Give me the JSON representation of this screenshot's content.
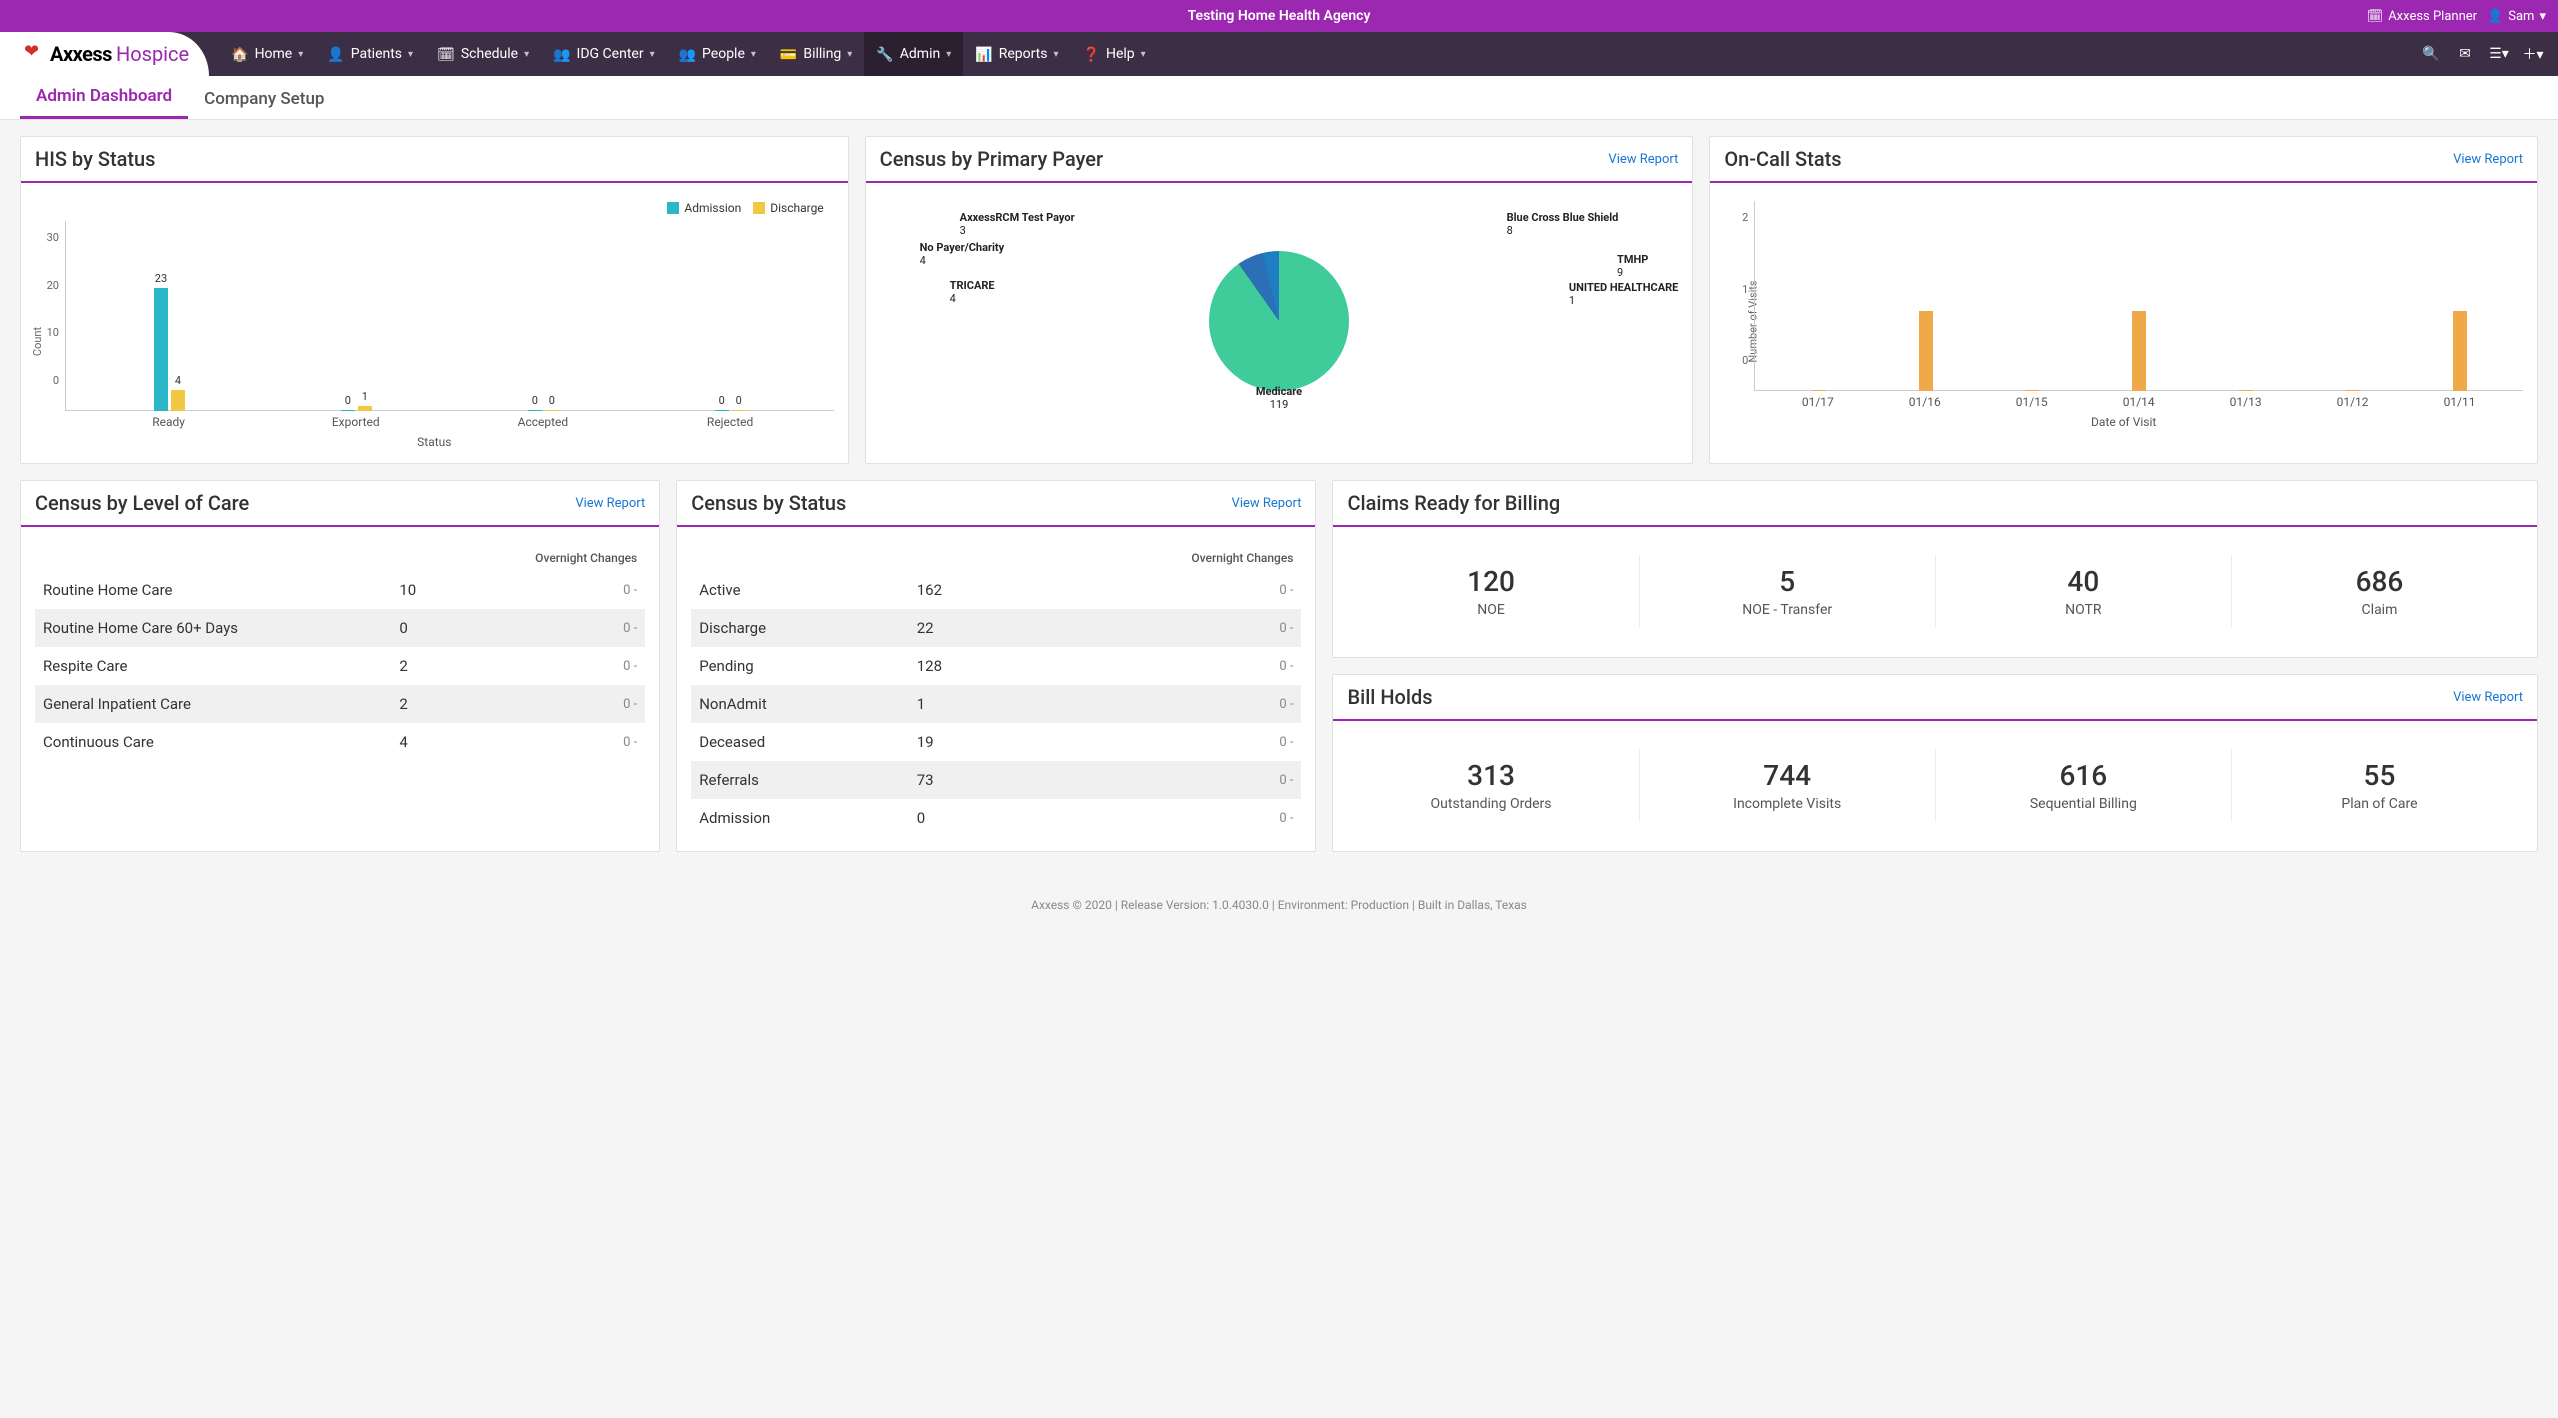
{
  "header": {
    "agency_name": "Testing Home Health Agency",
    "planner_link": "Axxess Planner",
    "user_name": "Sam"
  },
  "logo": {
    "brand": "Axxess",
    "product": "Hospice"
  },
  "nav": [
    {
      "icon": "home",
      "label": "Home"
    },
    {
      "icon": "person",
      "label": "Patients"
    },
    {
      "icon": "calendar",
      "label": "Schedule"
    },
    {
      "icon": "group",
      "label": "IDG Center"
    },
    {
      "icon": "people",
      "label": "People"
    },
    {
      "icon": "money",
      "label": "Billing"
    },
    {
      "icon": "wrench",
      "label": "Admin",
      "active": true
    },
    {
      "icon": "chart",
      "label": "Reports"
    },
    {
      "icon": "help",
      "label": "Help"
    }
  ],
  "tabs": [
    {
      "label": "Admin Dashboard",
      "active": true
    },
    {
      "label": "Company Setup"
    }
  ],
  "cards": {
    "his_by_status": {
      "title": "HIS by Status",
      "legend": [
        {
          "label": "Admission",
          "color": "#29b6c6"
        },
        {
          "label": "Discharge",
          "color": "#f2c744"
        }
      ],
      "xlabel": "Status",
      "ylabel": "Count"
    },
    "census_by_primary_payer": {
      "title": "Census by Primary Payer",
      "view_report": "View Report"
    },
    "on_call_stats": {
      "title": "On-Call Stats",
      "view_report": "View Report",
      "xlabel": "Date of Visit",
      "ylabel": "Number of Visits"
    },
    "census_by_level_of_care": {
      "title": "Census by Level of Care",
      "view_report": "View Report",
      "col_changes": "Overnight Changes",
      "rows": [
        {
          "label": "Routine Home Care",
          "value": "10",
          "change": "0 -"
        },
        {
          "label": "Routine Home Care 60+ Days",
          "value": "0",
          "change": "0 -"
        },
        {
          "label": "Respite Care",
          "value": "2",
          "change": "0 -"
        },
        {
          "label": "General Inpatient Care",
          "value": "2",
          "change": "0 -"
        },
        {
          "label": "Continuous Care",
          "value": "4",
          "change": "0 -"
        }
      ]
    },
    "census_by_status": {
      "title": "Census by Status",
      "view_report": "View Report",
      "col_changes": "Overnight Changes",
      "rows": [
        {
          "label": "Active",
          "value": "162",
          "change": "0 -"
        },
        {
          "label": "Discharge",
          "value": "22",
          "change": "0 -"
        },
        {
          "label": "Pending",
          "value": "128",
          "change": "0 -"
        },
        {
          "label": "NonAdmit",
          "value": "1",
          "change": "0 -"
        },
        {
          "label": "Deceased",
          "value": "19",
          "change": "0 -"
        },
        {
          "label": "Referrals",
          "value": "73",
          "change": "0 -"
        },
        {
          "label": "Admission",
          "value": "0",
          "change": "0 -"
        }
      ]
    },
    "claims_ready": {
      "title": "Claims Ready for Billing",
      "stats": [
        {
          "num": "120",
          "label": "NOE"
        },
        {
          "num": "5",
          "label": "NOE - Transfer"
        },
        {
          "num": "40",
          "label": "NOTR"
        },
        {
          "num": "686",
          "label": "Claim"
        }
      ]
    },
    "bill_holds": {
      "title": "Bill Holds",
      "view_report": "View Report",
      "stats": [
        {
          "num": "313",
          "label": "Outstanding Orders"
        },
        {
          "num": "744",
          "label": "Incomplete Visits"
        },
        {
          "num": "616",
          "label": "Sequential Billing"
        },
        {
          "num": "55",
          "label": "Plan of Care"
        }
      ]
    }
  },
  "footer": "Axxess © 2020 | Release Version: 1.0.4030.0 | Environment: Production | Built in Dallas, Texas",
  "chart_data": [
    {
      "id": "his_by_status",
      "type": "bar",
      "title": "HIS by Status",
      "xlabel": "Status",
      "ylabel": "Count",
      "ylim": [
        0,
        30
      ],
      "yticks": [
        0,
        10,
        20,
        30
      ],
      "categories": [
        "Ready",
        "Exported",
        "Accepted",
        "Rejected"
      ],
      "series": [
        {
          "name": "Admission",
          "color": "#29b6c6",
          "values": [
            23,
            0,
            0,
            0
          ]
        },
        {
          "name": "Discharge",
          "color": "#f2c744",
          "values": [
            4,
            1,
            0,
            0
          ]
        }
      ]
    },
    {
      "id": "census_by_primary_payer",
      "type": "pie",
      "title": "Census by Primary Payer",
      "slices": [
        {
          "label": "Medicare",
          "value": 119,
          "color": "#3fcb9a"
        },
        {
          "label": "TMHP",
          "value": 9,
          "color": "#2d6fb5"
        },
        {
          "label": "Blue Cross Blue Shield",
          "value": 8,
          "color": "#1f7dc1"
        },
        {
          "label": "No Payer/Charity",
          "value": 4,
          "color": "#b0b0b0"
        },
        {
          "label": "TRICARE",
          "value": 4,
          "color": "#9aa0a6"
        },
        {
          "label": "AxxessRCM Test Payor",
          "value": 3,
          "color": "#c0c4c8"
        },
        {
          "label": "UNITED HEALTHCARE",
          "value": 1,
          "color": "#5a8cb8"
        }
      ]
    },
    {
      "id": "on_call_stats",
      "type": "bar",
      "title": "On-Call Stats",
      "xlabel": "Date of Visit",
      "ylabel": "Number of Visits",
      "ylim": [
        0,
        2
      ],
      "yticks": [
        0,
        1,
        2
      ],
      "categories": [
        "01/17",
        "01/16",
        "01/15",
        "01/14",
        "01/13",
        "01/12",
        "01/11"
      ],
      "series": [
        {
          "name": "Visits",
          "color": "#f0a948",
          "values": [
            0,
            1,
            0,
            1,
            0,
            0,
            1
          ]
        }
      ]
    }
  ]
}
